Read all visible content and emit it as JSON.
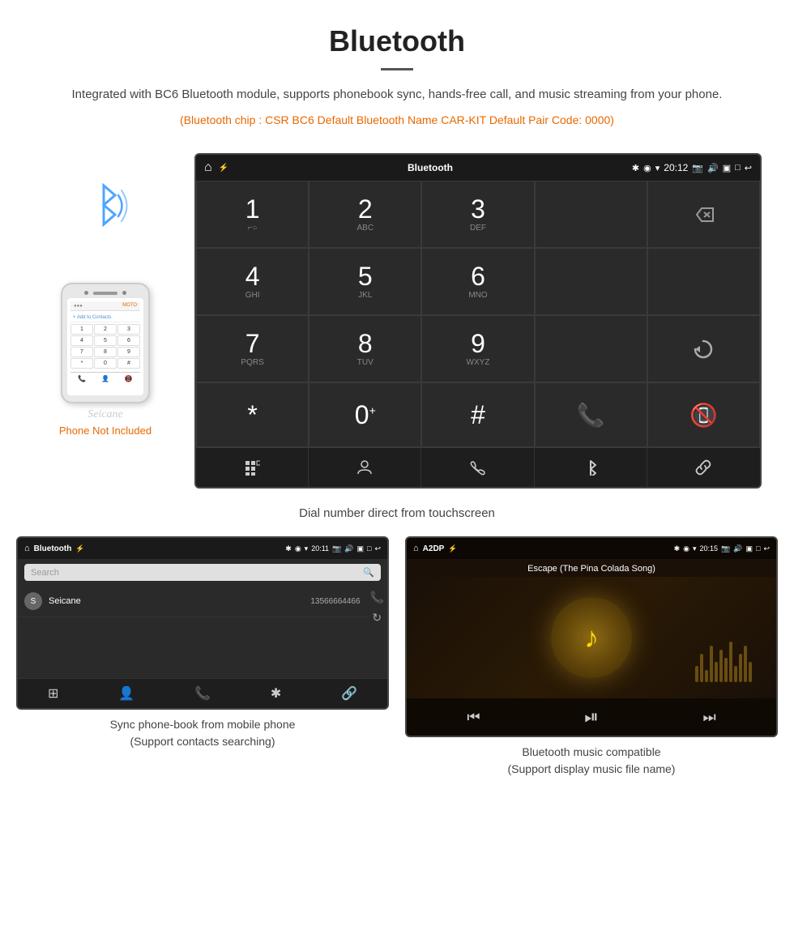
{
  "header": {
    "title": "Bluetooth",
    "description": "Integrated with BC6 Bluetooth module, supports phonebook sync, hands-free call, and music streaming from your phone.",
    "spec_line": "(Bluetooth chip : CSR BC6    Default Bluetooth Name CAR-KIT    Default Pair Code: 0000)"
  },
  "dialpad": {
    "status_bar": {
      "app_name": "Bluetooth",
      "time": "20:12"
    },
    "keys": [
      {
        "number": "1",
        "letters": "⌐○"
      },
      {
        "number": "2",
        "letters": "ABC"
      },
      {
        "number": "3",
        "letters": "DEF"
      },
      {
        "number": "",
        "letters": ""
      },
      {
        "number": "",
        "letters": "backspace"
      },
      {
        "number": "4",
        "letters": "GHI"
      },
      {
        "number": "5",
        "letters": "JKL"
      },
      {
        "number": "6",
        "letters": "MNO"
      },
      {
        "number": "",
        "letters": ""
      },
      {
        "number": "",
        "letters": ""
      },
      {
        "number": "7",
        "letters": "PQRS"
      },
      {
        "number": "8",
        "letters": "TUV"
      },
      {
        "number": "9",
        "letters": "WXYZ"
      },
      {
        "number": "",
        "letters": ""
      },
      {
        "number": "",
        "letters": "refresh"
      },
      {
        "number": "*",
        "letters": ""
      },
      {
        "number": "0",
        "letters": "+"
      },
      {
        "number": "#",
        "letters": ""
      },
      {
        "number": "",
        "letters": "call"
      },
      {
        "number": "",
        "letters": "endcall"
      }
    ],
    "bottom_icons": [
      "grid",
      "person",
      "phone",
      "bluetooth",
      "link"
    ],
    "caption": "Dial number direct from touchscreen"
  },
  "phonebook": {
    "status_bar": {
      "app_name": "Bluetooth",
      "time": "20:11"
    },
    "search_placeholder": "Search",
    "contacts": [
      {
        "initial": "S",
        "name": "Seicane",
        "number": "13566664466"
      }
    ],
    "caption_line1": "Sync phone-book from mobile phone",
    "caption_line2": "(Support contacts searching)"
  },
  "music": {
    "status_bar": {
      "app_name": "A2DP",
      "time": "20:15"
    },
    "song_title": "Escape (The Pina Colada Song)",
    "caption_line1": "Bluetooth music compatible",
    "caption_line2": "(Support display music file name)"
  },
  "phone_area": {
    "not_included_label": "Phone Not Included",
    "seicane_watermark": "Seicane"
  }
}
